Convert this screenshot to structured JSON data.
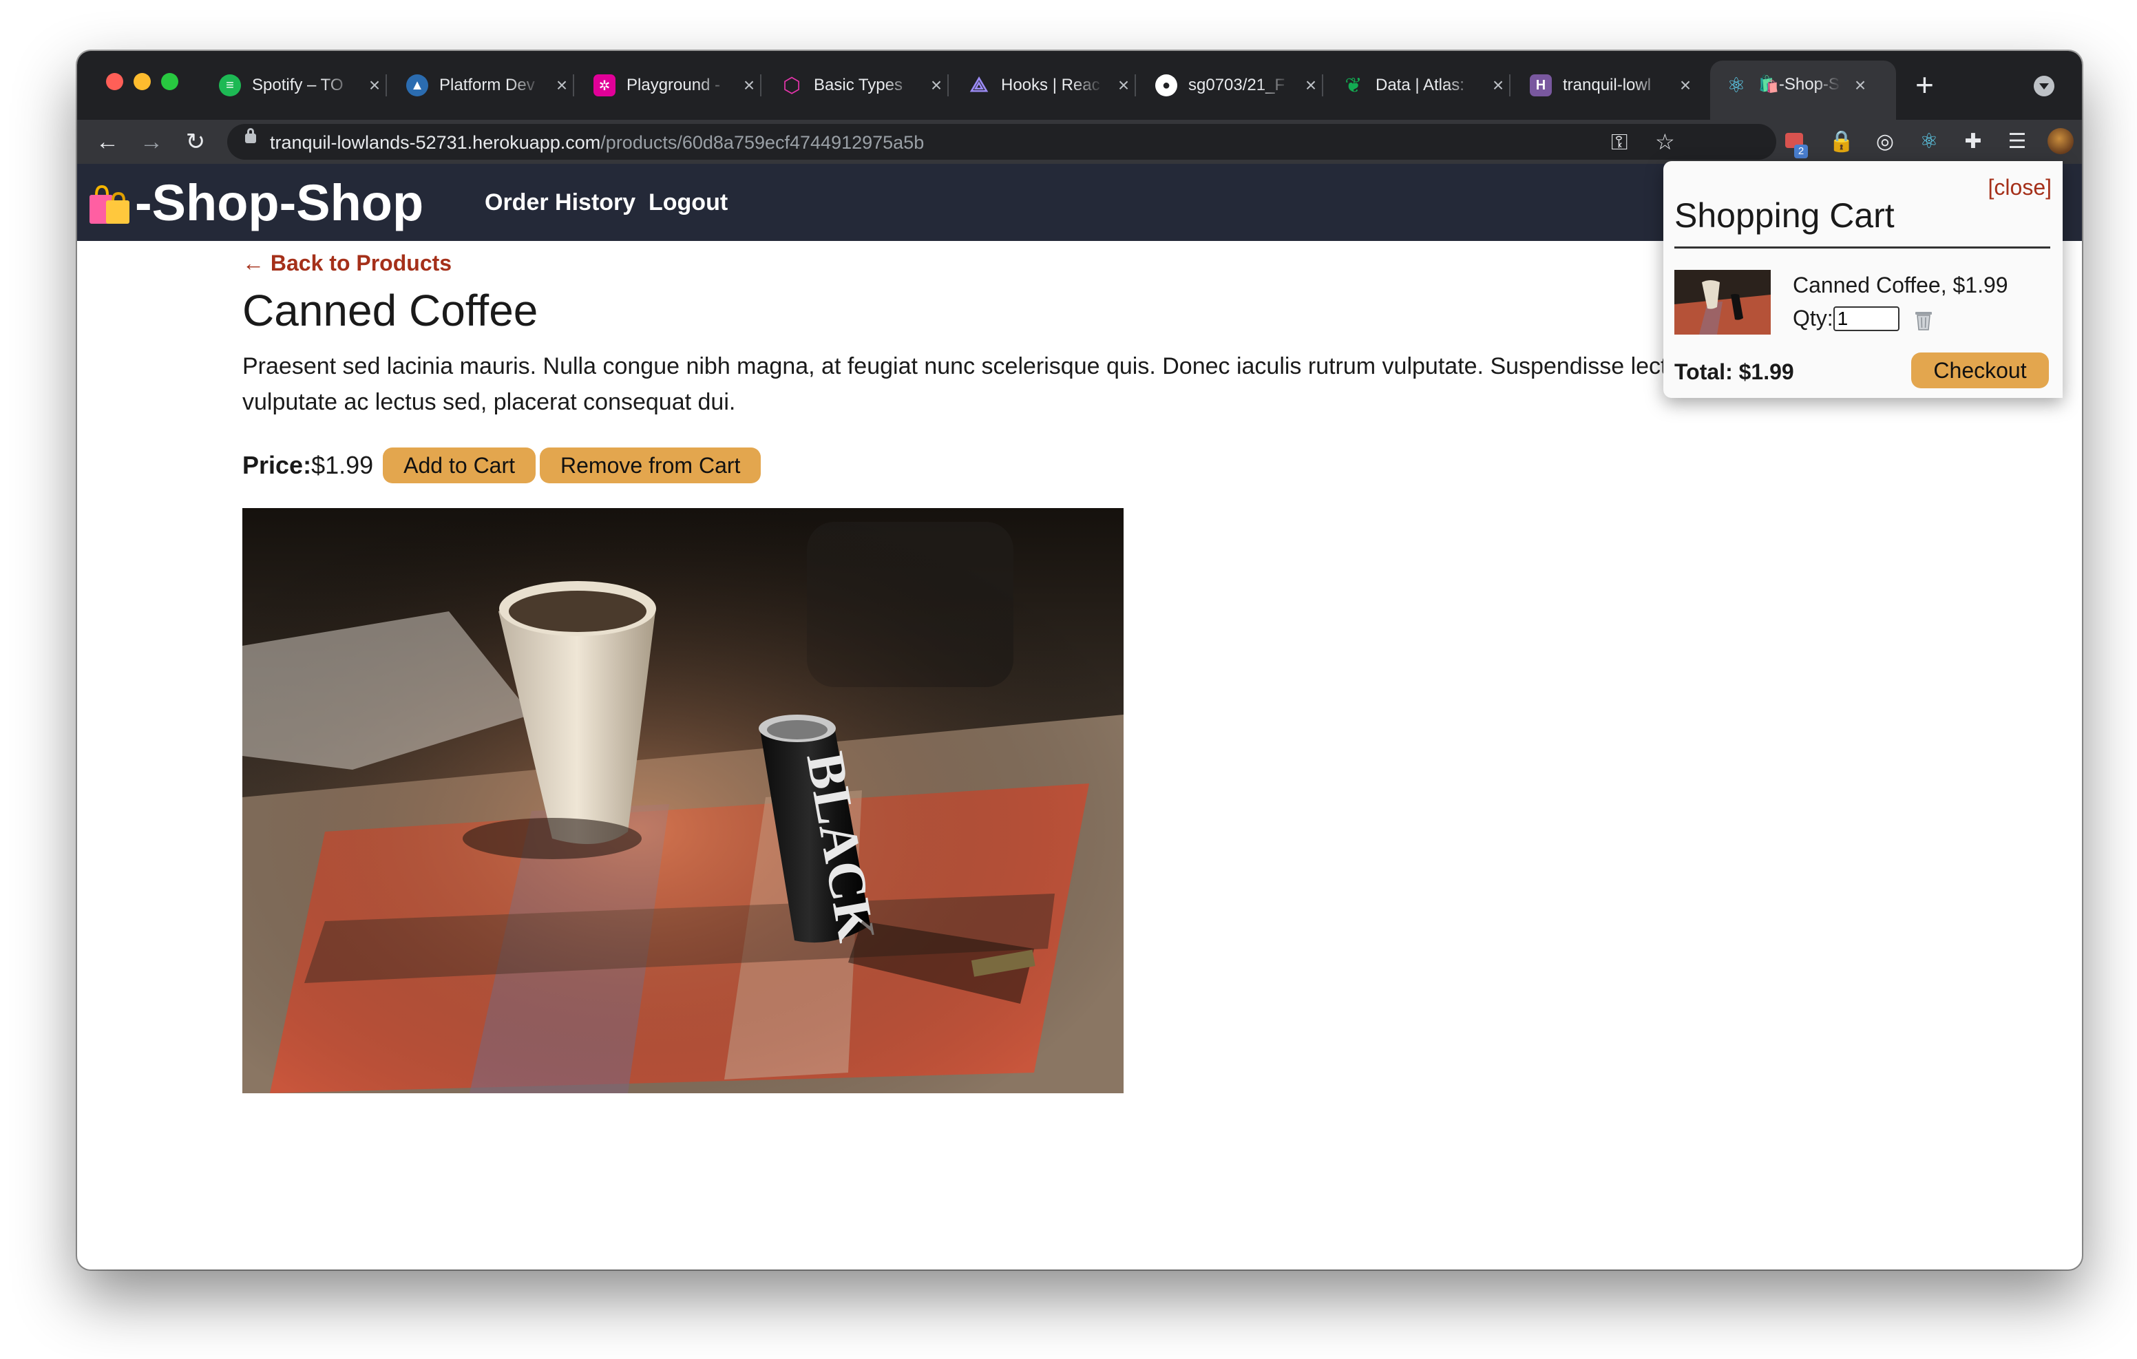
{
  "browser": {
    "tabs": [
      {
        "title": "Spotify – TO",
        "icon": "spotify-icon",
        "color": "#1db954",
        "active": false
      },
      {
        "title": "Platform Dev",
        "icon": "platform-icon",
        "color": "#4aa3ff",
        "active": false
      },
      {
        "title": "Playground -",
        "icon": "graphql-playground-icon",
        "color": "#e10098",
        "active": false
      },
      {
        "title": "Basic Types",
        "icon": "graphql-icon",
        "color": "#e535ab",
        "active": false
      },
      {
        "title": "Hooks | Reac",
        "icon": "apollo-icon",
        "color": "#7b68ee",
        "active": false
      },
      {
        "title": "sg0703/21_F",
        "icon": "github-icon",
        "color": "#ffffff",
        "active": false
      },
      {
        "title": "Data | Atlas:",
        "icon": "mongodb-leaf-icon",
        "color": "#13aa52",
        "active": false
      },
      {
        "title": "tranquil-lowl",
        "icon": "heroku-icon",
        "color": "#79589f",
        "active": false
      },
      {
        "title": "🛍️-Shop-Sh",
        "icon": "react-icon",
        "color": "#61dafb",
        "active": true
      }
    ],
    "new_tab_label": "+",
    "url_host": "tranquil-lowlands-52731.herokuapp.com",
    "url_path": "/products/60d8a759ecf4744912975a5b",
    "extension_badge": "2"
  },
  "site": {
    "brand": "-Shop-Shop",
    "nav": {
      "order_history": "Order History",
      "logout": "Logout"
    }
  },
  "product": {
    "back_link": "← Back to Products",
    "name": "Canned Coffee",
    "description": "Praesent sed lacinia mauris. Nulla congue nibh magna, at feugiat nunc scelerisque quis. Donec iaculis rutrum vulputate. Suspendisse lectus sem, vulputate ac lectus sed, placerat consequat dui.",
    "price_label": "Price:",
    "price": "$1.99",
    "add_to_cart": "Add to Cart",
    "remove_from_cart": "Remove from Cart",
    "image_alt": "canned coffee photo"
  },
  "cart": {
    "close": "[close]",
    "title": "Shopping Cart",
    "item_text": "Canned Coffee, $1.99",
    "qty_label": "Qty:",
    "qty_value": "1",
    "total": "Total: $1.99",
    "checkout": "Checkout"
  },
  "colors": {
    "accent_button": "#e3a64e",
    "header_bg": "#242938",
    "link_red": "#a5301a"
  }
}
